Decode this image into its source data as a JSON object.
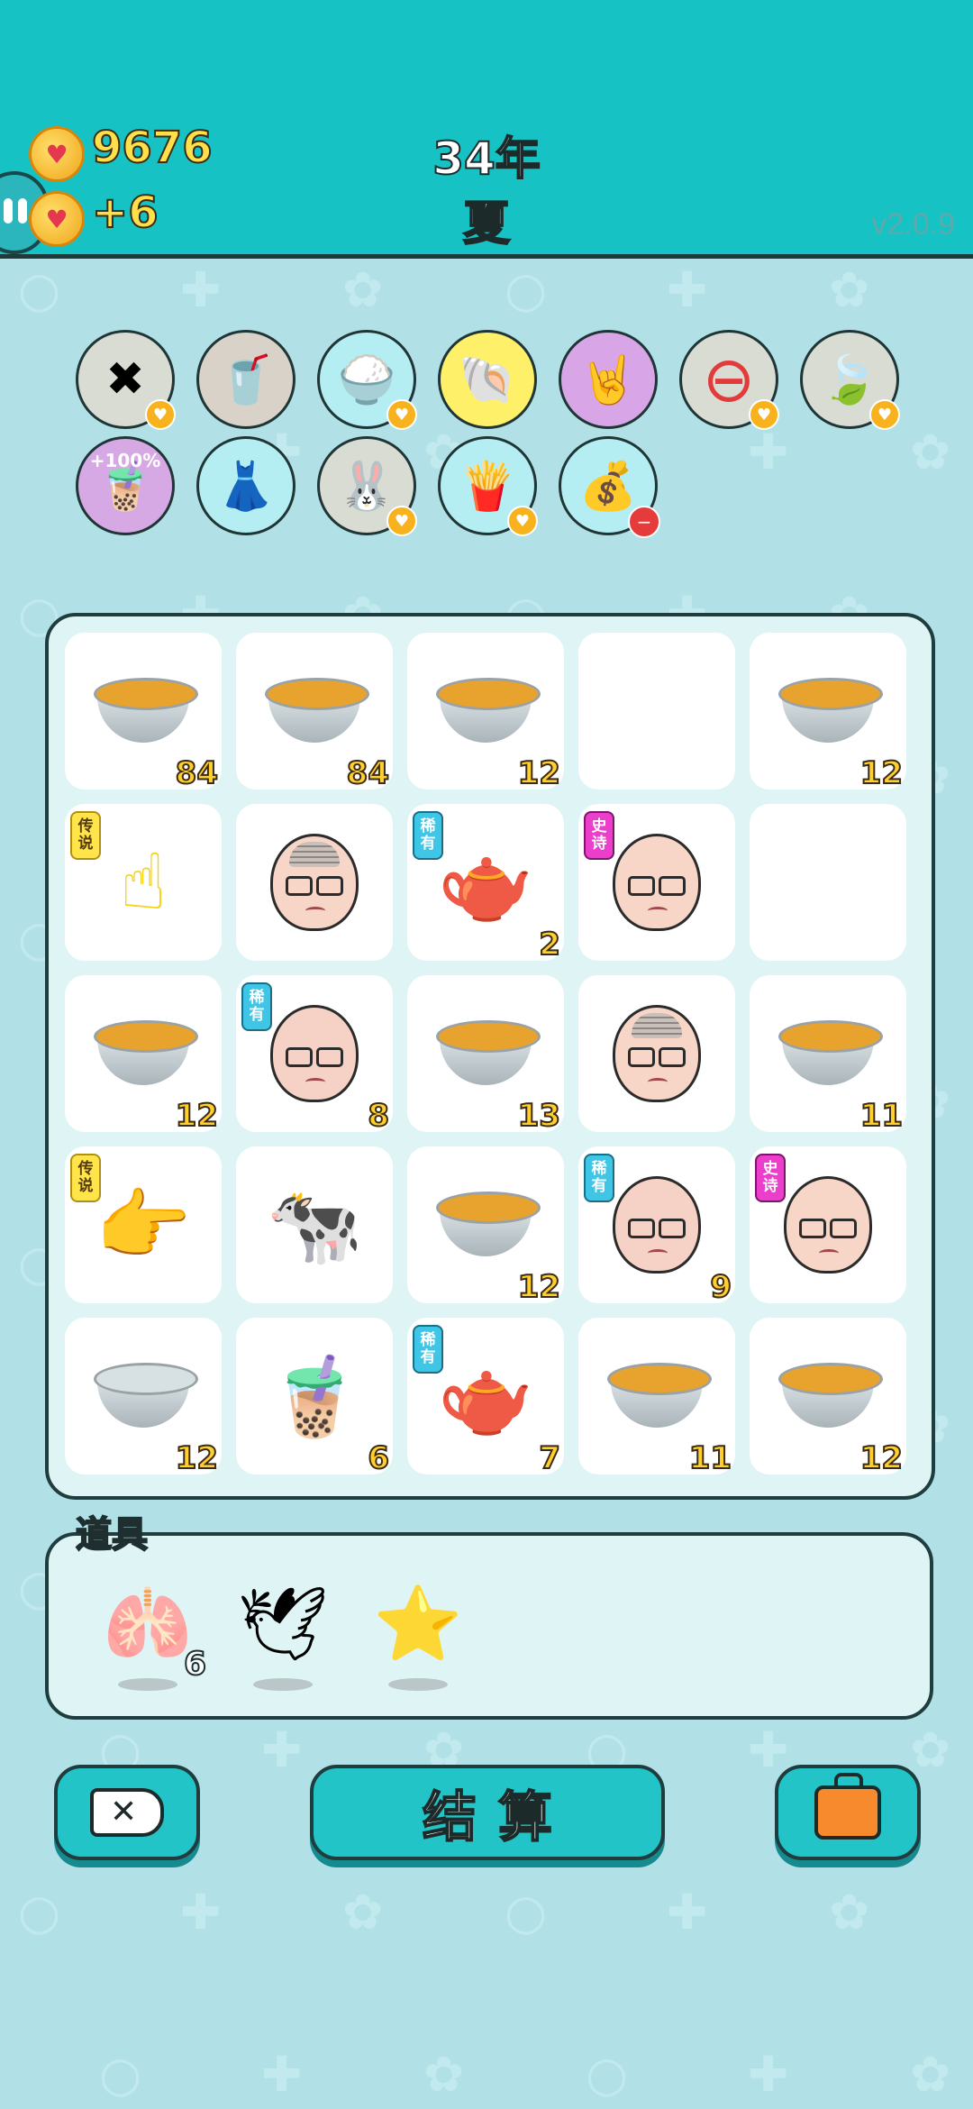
{
  "header": {
    "coins": "9676",
    "income": "+6",
    "year": "34年",
    "season": "夏",
    "version": "v2.0.9"
  },
  "relics": [
    {
      "name": "remove-tag-icon",
      "badge": "heart",
      "color": "#d9dcd3"
    },
    {
      "name": "milk-tea-icon",
      "badge": "",
      "color": "#d9d2c8"
    },
    {
      "name": "rice-bowl-icon",
      "badge": "heart",
      "color": "#b4edf2"
    },
    {
      "name": "shell-icon",
      "badge": "",
      "color": "#fff06a"
    },
    {
      "name": "rock-hand-icon",
      "badge": "",
      "color": "#d8a6e6"
    },
    {
      "name": "minus-sign-icon",
      "badge": "heart",
      "color": "#d9dcd3"
    },
    {
      "name": "leaf-icon",
      "badge": "heart",
      "color": "#d9dcd3"
    },
    {
      "name": "milk-tea-boost-icon",
      "badge": "",
      "label": "+100%",
      "color": "#d7a9e4"
    },
    {
      "name": "skirt-icon",
      "badge": "",
      "color": "#b4edf2"
    },
    {
      "name": "rabbit-icon",
      "badge": "heart",
      "color": "#d9dcd3"
    },
    {
      "name": "fries-icon",
      "badge": "heart",
      "color": "#b4edf2"
    },
    {
      "name": "money-bag-icon",
      "badge": "stop",
      "color": "#b4edf2"
    }
  ],
  "board": [
    {
      "type": "bowl",
      "count": "84"
    },
    {
      "type": "bowl",
      "count": "84"
    },
    {
      "type": "bowl",
      "count": "12"
    },
    {
      "type": "empty",
      "count": ""
    },
    {
      "type": "bowl",
      "count": "12"
    },
    {
      "type": "hand-point-up",
      "count": "",
      "tag": "传说"
    },
    {
      "type": "face-hair",
      "count": ""
    },
    {
      "type": "teapot",
      "count": "2",
      "tag": "稀有"
    },
    {
      "type": "face-sad",
      "count": "",
      "tag": "史诗"
    },
    {
      "type": "empty",
      "count": ""
    },
    {
      "type": "bowl",
      "count": "12"
    },
    {
      "type": "face-bald",
      "count": "8",
      "tag": "稀有"
    },
    {
      "type": "bowl",
      "count": "13"
    },
    {
      "type": "face-hair",
      "count": ""
    },
    {
      "type": "bowl",
      "count": "11"
    },
    {
      "type": "hand-point-right",
      "count": "",
      "tag": "传说"
    },
    {
      "type": "cow",
      "count": ""
    },
    {
      "type": "bowl",
      "count": "12"
    },
    {
      "type": "face-bald",
      "count": "9",
      "tag": "稀有"
    },
    {
      "type": "face-sad",
      "count": "",
      "tag": "史诗"
    },
    {
      "type": "bowl-empty",
      "count": "12"
    },
    {
      "type": "milk-tea",
      "count": "6"
    },
    {
      "type": "teapot",
      "count": "7",
      "tag": "稀有"
    },
    {
      "type": "bowl",
      "count": "11"
    },
    {
      "type": "bowl",
      "count": "12"
    }
  ],
  "items": {
    "title": "道具",
    "list": [
      {
        "name": "liver-icon",
        "count": "6"
      },
      {
        "name": "white-bird-icon",
        "count": ""
      },
      {
        "name": "star-icon",
        "count": ""
      }
    ]
  },
  "buttons": {
    "settle": "结算"
  }
}
